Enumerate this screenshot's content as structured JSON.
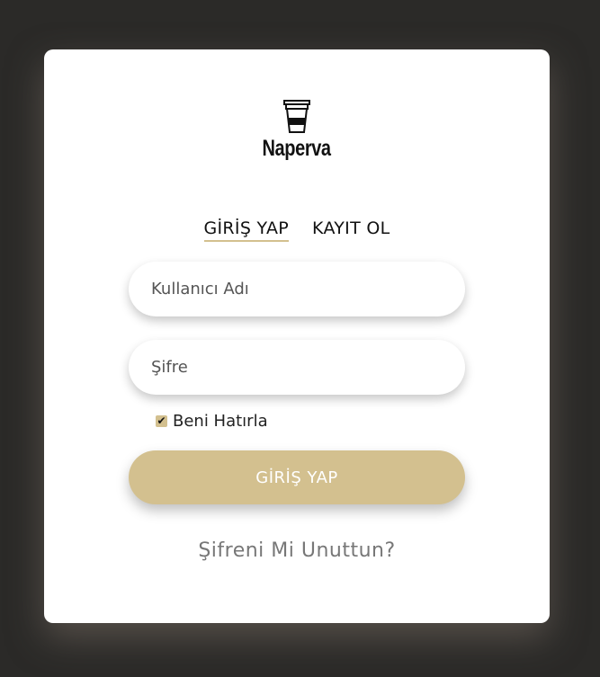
{
  "brand": {
    "name": "Naperva",
    "logo_icon": "coffee-cup-icon"
  },
  "tabs": [
    {
      "label": "GİRİŞ YAP",
      "active": true
    },
    {
      "label": "KAYIT OL",
      "active": false
    }
  ],
  "form": {
    "username": {
      "placeholder": "Kullanıcı Adı",
      "value": ""
    },
    "password": {
      "placeholder": "Şifre",
      "value": ""
    },
    "remember": {
      "label": "Beni Hatırla",
      "checked": true
    },
    "submit_label": "GİRİŞ YAP"
  },
  "forgot_link": "Şifreni Mi Unuttun?",
  "colors": {
    "accent": "#d3c08f",
    "background": "#2b2a28",
    "card": "#ffffff"
  }
}
